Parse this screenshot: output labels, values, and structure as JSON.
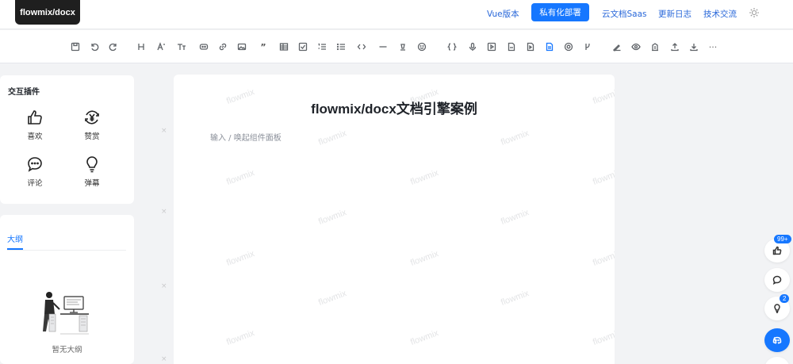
{
  "header": {
    "logo": "flowmix/docx",
    "links": [
      "Vue版本",
      "私有化部署",
      "云文档Saas",
      "更新日志",
      "技术交流"
    ]
  },
  "toolbar": {
    "icons": [
      "save-icon",
      "undo-icon",
      "redo-icon",
      "heading-icon",
      "font-size-icon",
      "text-style-icon",
      "embed-icon",
      "link-icon",
      "image-icon",
      "quote-icon",
      "table-icon",
      "checkbox-icon",
      "ordered-list-icon",
      "bullet-list-icon",
      "code-icon",
      "divider-icon",
      "clear-format-icon",
      "emoji-icon",
      "code-block-icon",
      "audio-icon",
      "video-icon",
      "pdf-icon",
      "media-icon",
      "document-icon",
      "chrome-icon",
      "branch-icon",
      "sign-icon",
      "preview-icon",
      "building-icon",
      "upload-icon",
      "download-icon",
      "more-icon"
    ],
    "more_label": "···"
  },
  "plugins": {
    "title": "交互插件",
    "items": [
      {
        "label": "喜欢",
        "icon": "thumb-up-icon"
      },
      {
        "label": "赞赏",
        "icon": "reward-icon"
      },
      {
        "label": "评论",
        "icon": "comment-icon"
      },
      {
        "label": "弹幕",
        "icon": "bulb-icon"
      }
    ]
  },
  "outline": {
    "tab": "大纲",
    "empty_text": "暂无大纲"
  },
  "editor": {
    "title": "flowmix/docx文档引擎案例",
    "placeholder": "输入 / 唤起组件面板",
    "watermark": "flowmix"
  },
  "floating": {
    "like_badge": "99+",
    "bulb_badge": "2"
  },
  "colors": {
    "accent": "#1677ff",
    "logo_bg": "#1f1f1f",
    "page_bg": "#f2f3f5"
  }
}
